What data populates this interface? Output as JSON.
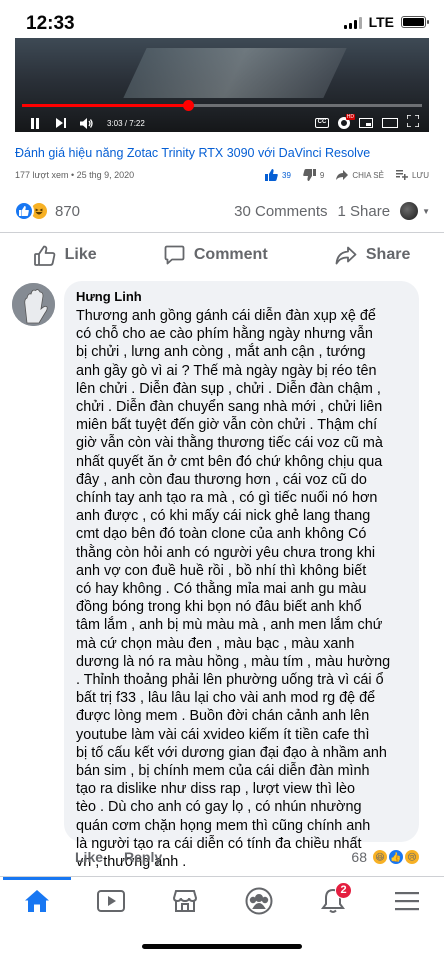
{
  "status_bar": {
    "time": "12:33",
    "network": "LTE"
  },
  "video_player": {
    "time_readout": "3:03 / 7:22",
    "progress_fraction": 0.414,
    "settings_badge": "HD"
  },
  "video_info": {
    "title": "Đánh giá hiệu năng Zotac Trinity RTX 3090 với DaVinci Resolve",
    "views_date": "177 lượt xem • 25 thg 9, 2020",
    "likes": "39",
    "dislikes": "9",
    "share_label": "CHIA SẺ",
    "save_label": "LƯU"
  },
  "post_stats": {
    "reaction_count": "870",
    "comments": "30 Comments",
    "shares": "1 Share"
  },
  "post_actions": {
    "like": "Like",
    "comment": "Comment",
    "share": "Share"
  },
  "comment": {
    "author": "Hưng Linh",
    "lines": [
      "Thương anh gồng gánh cái diễn đàn xụp xệ để",
      "có chỗ cho ae cào phím hằng ngày nhưng vẫn",
      "bị chửi , lưng anh còng , mắt anh cận , tướng",
      "anh gầy gò vì ai ? Thế mà ngày ngày bị réo tên",
      "lên chửi . Diễn đàn sụp , chửi . Diễn đàn chậm ,",
      "chửi . Diễn đàn chuyển sang nhà mới , chửi liên",
      "miên bất tuyệt đến giờ vẫn còn chửi . Thậm chí",
      "giờ vẫn còn vài thằng thương tiếc cái voz cũ mà",
      "nhất quyết ăn ở cmt bên đó chứ không chịu qua",
      "đây , anh còn đau thương hơn , cái voz cũ do",
      "chính tay anh tạo ra mà , có gì tiếc nuối nó hơn",
      "anh được , có khi mấy cái nick ghẻ lang thang",
      "cmt dạo bên đó toàn clone của anh không Có",
      "thằng còn hỏi anh có người yêu chưa trong khi",
      "anh vợ con đuề huề rồi , bồ nhí thì không biết",
      "có hay không . Có thằng mỉa mai anh gu màu",
      "đồng bóng trong khi bọn nó đâu biết anh khổ",
      "tâm lắm , anh bị mù màu mà , anh men lắm chứ",
      "mà cứ chọn màu đen , màu bạc , màu xanh",
      "dương là nó ra màu hồng , màu tím , màu hường",
      ". Thỉnh thoảng phải lên phường uống trà vì cái ổ",
      "bất trị f33 , lâu lâu lại cho vài anh mod rg đệ để",
      "được lòng mem . Buồn đời chán cảnh anh lên",
      "youtube làm vài cái xvideo kiếm ít tiền cafe thì",
      "bị tố cấu kết với dương gian đại đạo à nhầm anh",
      "bán sim , bị chính mem của cái diễn đàn mình",
      "tạo ra dislike như diss rap , lượt view thì lèo",
      "tèo . Dù cho anh có gay lọ , có nhún nhường",
      "quán cơm chặn họng mem thì cũng chính anh",
      "là người tạo ra cái diễn có tính đa chiều nhất",
      "vn , thương anh ."
    ],
    "like_label": "Like",
    "reply_label": "Reply",
    "reaction_count": "68"
  },
  "tab_bar": {
    "notification_count": "2"
  },
  "colors": {
    "facebook_blue": "#1877f2",
    "youtube_red": "#ff0000",
    "link_blue": "#065fd4",
    "gray_text": "#65676b",
    "bubble_bg": "#f0f2f5"
  }
}
